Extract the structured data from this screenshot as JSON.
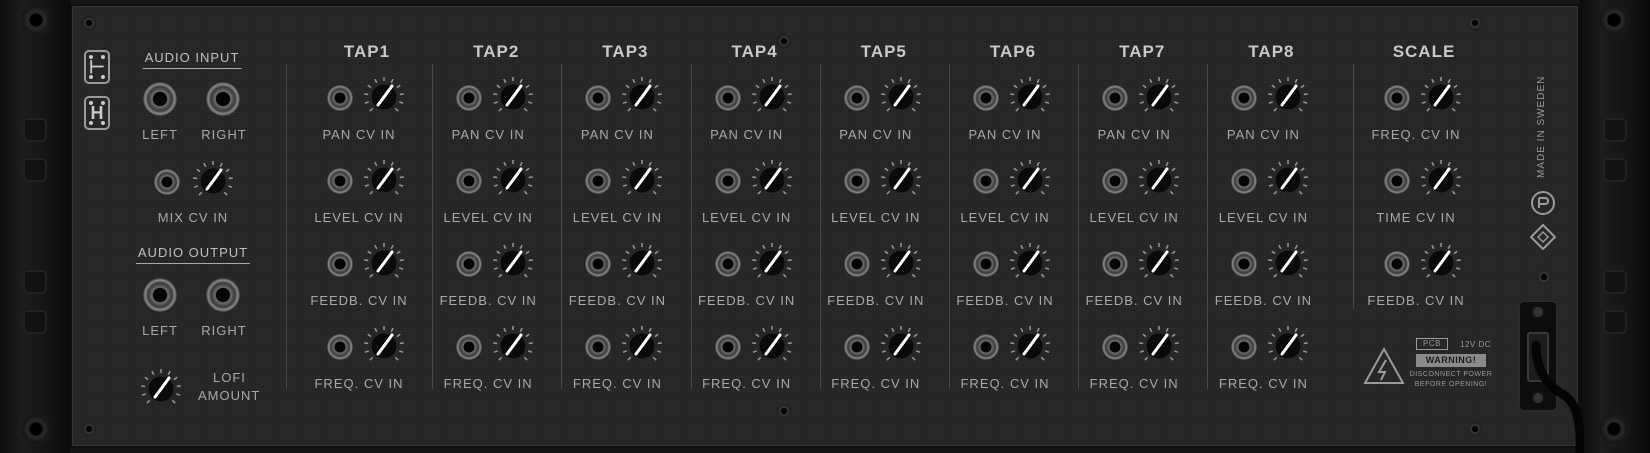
{
  "left_section": {
    "audio_input": {
      "title": "AUDIO INPUT",
      "left": "LEFT",
      "right": "RIGHT"
    },
    "mix_cv_in": "MIX CV IN",
    "audio_output": {
      "title": "AUDIO OUTPUT",
      "left": "LEFT",
      "right": "RIGHT"
    },
    "lofi_line1": "LOFI",
    "lofi_line2": "AMOUNT"
  },
  "taps": [
    {
      "name": "TAP1",
      "rows": [
        "PAN CV IN",
        "LEVEL CV IN",
        "FEEDB. CV IN",
        "FREQ. CV IN"
      ]
    },
    {
      "name": "TAP2",
      "rows": [
        "PAN CV IN",
        "LEVEL CV IN",
        "FEEDB. CV IN",
        "FREQ. CV IN"
      ]
    },
    {
      "name": "TAP3",
      "rows": [
        "PAN CV IN",
        "LEVEL CV IN",
        "FEEDB. CV IN",
        "FREQ. CV IN"
      ]
    },
    {
      "name": "TAP4",
      "rows": [
        "PAN CV IN",
        "LEVEL CV IN",
        "FEEDB. CV IN",
        "FREQ. CV IN"
      ]
    },
    {
      "name": "TAP5",
      "rows": [
        "PAN CV IN",
        "LEVEL CV IN",
        "FEEDB. CV IN",
        "FREQ. CV IN"
      ]
    },
    {
      "name": "TAP6",
      "rows": [
        "PAN CV IN",
        "LEVEL CV IN",
        "FEEDB. CV IN",
        "FREQ. CV IN"
      ]
    },
    {
      "name": "TAP7",
      "rows": [
        "PAN CV IN",
        "LEVEL CV IN",
        "FEEDB. CV IN",
        "FREQ. CV IN"
      ]
    },
    {
      "name": "TAP8",
      "rows": [
        "PAN CV IN",
        "LEVEL CV IN",
        "FEEDB. CV IN",
        "FREQ. CV IN"
      ]
    }
  ],
  "scale": {
    "name": "SCALE",
    "rows": [
      "FREQ. CV IN",
      "TIME CV IN",
      "FEEDB. CV IN"
    ]
  },
  "right_section": {
    "made_in": "MADE IN SWEDEN",
    "pcb": "PCB",
    "power": "12V DC",
    "warning": "WARNING!",
    "warning_line1": "DISCONNECT POWER",
    "warning_line2": "BEFORE OPENING!"
  },
  "icons": {
    "routing_a": "cable-routing-icon",
    "routing_b": "cable-routing-icon",
    "logo_a": "propellerhead-logo-icon",
    "logo_b": "reason-logo-icon",
    "hazard": "high-voltage-warning-icon"
  },
  "colors": {
    "panel": "#252525",
    "text": "#a9a9a9",
    "header": "#c9c9c9"
  }
}
